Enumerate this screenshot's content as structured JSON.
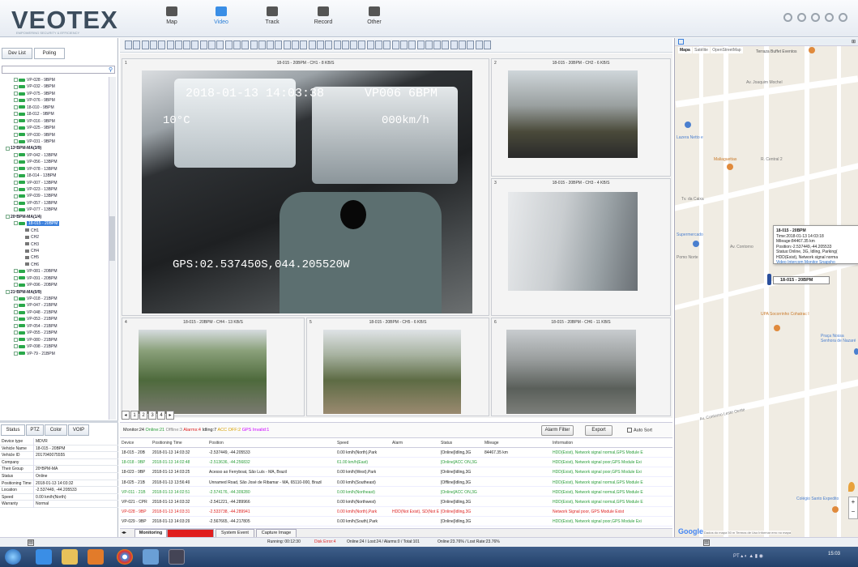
{
  "app": {
    "logo": "VEOTEX",
    "logo_sub": "EMPOWERING SECURITY & EFFICIENCY"
  },
  "nav": [
    {
      "label": "Map",
      "icon": "map-icon"
    },
    {
      "label": "Video",
      "icon": "video-icon"
    },
    {
      "label": "Track",
      "icon": "track-icon"
    },
    {
      "label": "Record",
      "icon": "record-icon"
    },
    {
      "label": "Other",
      "icon": "other-icon"
    }
  ],
  "left_tabs": [
    "Dev List",
    "Poling"
  ],
  "tree": [
    {
      "label": "VP-028 - 9BPM",
      "kind": "veh"
    },
    {
      "label": "VP-032 - 9BPM",
      "kind": "veh"
    },
    {
      "label": "VP-075 - 9BPM",
      "kind": "veh"
    },
    {
      "label": "VP-076 - 9BPM",
      "kind": "veh"
    },
    {
      "label": "18-010 - 9BPM",
      "kind": "veh"
    },
    {
      "label": "18-012 - 9BPM",
      "kind": "veh"
    },
    {
      "label": "VP-016 - 9BPM",
      "kind": "veh"
    },
    {
      "label": "VP-025 - 9BPM",
      "kind": "veh"
    },
    {
      "label": "VP-030 - 9BPM",
      "kind": "veh"
    },
    {
      "label": "VP-031 - 9BPM",
      "kind": "veh"
    },
    {
      "label": "13ºBPM-MA(3/9)",
      "kind": "grp"
    },
    {
      "label": "VP-042 - 13BPM",
      "kind": "veh"
    },
    {
      "label": "VP-056 - 13BPM",
      "kind": "veh"
    },
    {
      "label": "VP-078 - 13BPM",
      "kind": "veh"
    },
    {
      "label": "18-014 - 13BPM",
      "kind": "veh"
    },
    {
      "label": "VP-007 - 13BPM",
      "kind": "veh"
    },
    {
      "label": "VP-023 - 13BPM",
      "kind": "veh"
    },
    {
      "label": "VP-039 - 13BPM",
      "kind": "veh"
    },
    {
      "label": "VP-057 - 13BPM",
      "kind": "veh"
    },
    {
      "label": "VP-077 - 13BPM",
      "kind": "veh"
    },
    {
      "label": "20ºBPM-MA(1/4)",
      "kind": "grp"
    },
    {
      "label": "18-015 - 20BPM",
      "kind": "sel"
    },
    {
      "label": "CH1",
      "kind": "ch"
    },
    {
      "label": "CH2",
      "kind": "ch"
    },
    {
      "label": "CH3",
      "kind": "ch"
    },
    {
      "label": "CH4",
      "kind": "ch"
    },
    {
      "label": "CH5",
      "kind": "ch"
    },
    {
      "label": "CH6",
      "kind": "ch"
    },
    {
      "label": "VP-081 - 20BPM",
      "kind": "veh"
    },
    {
      "label": "VP-091 - 20BPM",
      "kind": "veh"
    },
    {
      "label": "VP-096 - 20BPM",
      "kind": "veh"
    },
    {
      "label": "21ºBPM-MA(0/9)",
      "kind": "grp"
    },
    {
      "label": "VP-018 - 21BPM",
      "kind": "veh"
    },
    {
      "label": "VP-047 - 21BPM",
      "kind": "veh"
    },
    {
      "label": "VP-048 - 21BPM",
      "kind": "veh"
    },
    {
      "label": "VP-053 - 21BPM",
      "kind": "veh"
    },
    {
      "label": "VP-054 - 21BPM",
      "kind": "veh"
    },
    {
      "label": "VP-055 - 21BPM",
      "kind": "veh"
    },
    {
      "label": "VP-080 - 21BPM",
      "kind": "veh"
    },
    {
      "label": "VP-098 - 21BPM",
      "kind": "veh"
    },
    {
      "label": "VP-79 - 21BPM",
      "kind": "veh"
    }
  ],
  "lp_tabs": [
    "Status",
    "PTZ",
    "Color",
    "VOIP"
  ],
  "props": [
    [
      "Device type",
      "MDVR"
    ],
    [
      "Vehicle Name",
      "18-015 - 20BPM"
    ],
    [
      "Vehicle ID",
      "2017040075555"
    ],
    [
      "Company",
      ""
    ],
    [
      "Their Group",
      "20ºBPM-MA"
    ],
    [
      "Status",
      "Online"
    ],
    [
      "Positioning Time",
      "2018-01-13 14:03:32"
    ],
    [
      "Location",
      "-2.537449, -44.205533"
    ],
    [
      "Speed",
      "0.00 km/h(North)"
    ],
    [
      "Warranty",
      "Normal"
    ]
  ],
  "cells": [
    {
      "num": "1",
      "caption": "18-015 - 20BPM - CH1 - 8 KB/S",
      "osd_date": "2018-01-13 14:03:38",
      "osd_id": "VP006 6BPM",
      "osd_temp": "10°C",
      "osd_speed": "000km/h",
      "osd_gps": "GPS:02.537450S,044.205520W"
    },
    {
      "num": "2",
      "caption": "18-015 - 20BPM - CH2 - 6 KB/S"
    },
    {
      "num": "3",
      "caption": "18-015 - 20BPM - CH3 - 4 KB/S"
    },
    {
      "num": "4",
      "caption": "18-015 - 20BPM - CH4 - 13 KB/S"
    },
    {
      "num": "5",
      "caption": "18-015 - 20BPM - CH5 - 6 KB/S"
    },
    {
      "num": "6",
      "caption": "18-015 - 20BPM - CH6 - 11 KB/S"
    }
  ],
  "pager": [
    "1",
    "2",
    "3",
    "4"
  ],
  "monitor": {
    "monitor": "Monitor:24",
    "online": "Online:21",
    "offline": "Offline:3",
    "alarms": "Alarms:4",
    "idling": "Idling:7",
    "acc_off": "ACC OFF:2",
    "gps_invalid": "GPS Invalid:1",
    "alarm_filter": "Alarm Filter",
    "export": "Export",
    "auto_sort": "Auto Sort"
  },
  "table": {
    "headers": [
      "Device",
      "Positioning Time",
      "Position",
      "Speed",
      "Alarm",
      "Status",
      "Mileage",
      "Information"
    ],
    "rows": [
      {
        "c": [
          "18-015 - 20B",
          "2018-01-13 14:03:32",
          "-2.537449, -44.205533",
          "0.00 km/h(North),Park",
          "",
          "[Online]Idling,3G",
          "84467.35 km",
          "HDD(Exist), Network signal normal,GPS Module E"
        ],
        "col": "#222"
      },
      {
        "c": [
          "18-018 - 9BP",
          "2018-01-13 14:02:48",
          "-2.513636, -44.256832",
          "61.00 km/h(East)",
          "",
          "[Online]ACC ON,3G",
          "",
          "HDD(Exist), Network signal poor,GPS Module Exi"
        ],
        "col": "#2a9d3a"
      },
      {
        "c": [
          "18-023 - 9BP",
          "2018-01-13 14:03:25",
          "Acesso ao Ferryboat, São Luís - MA, Brazil",
          "0.00 km/h(West),Park",
          "",
          "[Online]Idling,3G",
          "",
          "HDD(Exist), Network signal poor,GPS Module Exi"
        ],
        "col": "#222"
      },
      {
        "c": [
          "18-025 - 21B",
          "2018-01-13 13:56:49",
          "Unnamed Road, São José de Ribamar - MA, 65110-000, Brazil",
          "0.00 km/h(Southeast)",
          "",
          "[Offline]Idling,3G",
          "",
          "HDD(Exist), Network signal normal,GPS Module E"
        ],
        "col": "#222"
      },
      {
        "c": [
          "VP-011 - 21B",
          "2018-01-13 14:02:51",
          "-2.574176, -44.309280",
          "0.00 km/h(Northeast)",
          "",
          "[Online]ACC ON,3G",
          "",
          "HDD(Exist), Network signal normal,GPS Module E"
        ],
        "col": "#2a9d3a"
      },
      {
        "c": [
          "VP-021 - CPR",
          "2018-01-13 14:03:32",
          "-2.541221, -44.289966",
          "0.00 km/h(Northwest)",
          "",
          "[Online]Idling,3G",
          "",
          "HDD(Exist), Network signal normal,GPS Module E"
        ],
        "col": "#222"
      },
      {
        "c": [
          "VP-028 - 9BP",
          "2018-01-13 14:03:31",
          "-2.533738, -44.289941",
          "0.00 km/h(North),Park",
          "HDD(Not Exist), SD(Not Ex",
          "[Online]Idling,3G",
          "",
          "Network Signal poor, GPS Module Exist"
        ],
        "col": "#d22"
      },
      {
        "c": [
          "VP-029 - 9BP",
          "2018-01-13 14:03:29",
          "-2.567665, -44.217805",
          "0.00 km/h(South),Park",
          "",
          "[Online]Idling,3G",
          "",
          "HDD(Exist), Network signal poor,GPS Module Exi"
        ],
        "col": "#222"
      }
    ]
  },
  "bottom_tabs": [
    "Monitoring",
    "Alarm Information",
    "System Event",
    "Capture Image"
  ],
  "statusbar": {
    "running": "Running: 00:12:30",
    "disk_error": "Disk Error:4",
    "counts": "Online:24 / Lost:24 / Alarms:0 / Total:101",
    "rate": "Online:23.76% / Lost Rate:23.76%"
  },
  "map": {
    "types": [
      "Mapa",
      "Satélite",
      "OpenStreetMap"
    ],
    "places": [
      "Terraza Buffet Eventos",
      "Av. Joaquim Mochel",
      "Lazera Netto e",
      "Maliaguettas",
      "R. Central 2",
      "Tv. da Caixa",
      "Supermercado",
      "Av. Contorno",
      "Pomo Norte",
      "UPA Socorrinho Cohatrac I",
      "Praça Nossa Senhora de Nazaré",
      "Av. Contorno Leste Oeste",
      "Colégio Santo Expedito",
      "Google"
    ],
    "popup": {
      "title": "18-015 - 20BPM",
      "time": "Time:2018-01-13 14:03:18",
      "mileage": "Mileage:84467.35 km",
      "position": "Position:-2.537449,-44.205533",
      "status": "Status:Online, 3G, Idling, Parking(",
      "hdd": "HDD(Exist), Network signal norma",
      "links": "Video Intercom Monitor Snapsho"
    },
    "marker_label": "18-015 - 20BPM",
    "attribution": "Dados do mapa  50 m  Termos de Uso  Informar erro no mapa"
  },
  "taskbar": {
    "clock": "15:03"
  }
}
